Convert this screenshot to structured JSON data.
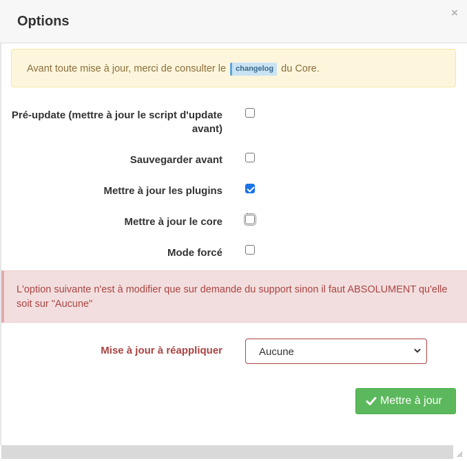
{
  "modal": {
    "title": "Options",
    "close_glyph": "×"
  },
  "warning": {
    "text_before": "Avant toute mise à jour, merci de consulter le",
    "changelog_label": "changelog",
    "text_after": "du Core."
  },
  "options": [
    {
      "label_line1": "Pré-update (mettre à jour le script d'update",
      "label_line2": "avant)",
      "checked": false
    },
    {
      "label": "Sauvegarder avant",
      "checked": false
    },
    {
      "label": "Mettre à jour les plugins",
      "checked": true
    },
    {
      "label": "Mettre à jour le core",
      "checked": false
    },
    {
      "label": "Mode forcé",
      "checked": false
    }
  ],
  "danger": {
    "text": "L'option suivante n'est à modifier que sur demande du support sinon il faut ABSOLUMENT qu'elle soit sur \"Aucune\""
  },
  "reapply": {
    "label": "Mise à jour à réappliquer",
    "selected": "Aucune"
  },
  "submit": {
    "label": "Mettre à jour",
    "icon": "check-icon"
  },
  "colors": {
    "warning_bg": "#fdf6dc",
    "warning_text": "#8a6d3b",
    "danger_bg": "#f2dede",
    "danger_text": "#a94442",
    "success_button": "#5cb85c",
    "checkbox_checked": "#1a73e8"
  }
}
